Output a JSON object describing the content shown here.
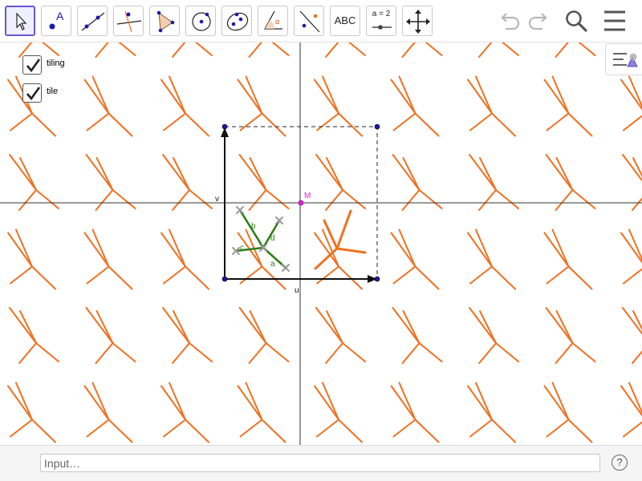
{
  "toolbar": {
    "tools": [
      {
        "id": "move",
        "text": ""
      },
      {
        "id": "point",
        "text": ""
      },
      {
        "id": "line",
        "text": ""
      },
      {
        "id": "perpendicular",
        "text": ""
      },
      {
        "id": "polygon",
        "text": ""
      },
      {
        "id": "circle",
        "text": ""
      },
      {
        "id": "ellipse",
        "text": ""
      },
      {
        "id": "angle",
        "text": ""
      },
      {
        "id": "reflect",
        "text": ""
      },
      {
        "id": "text",
        "text": "ABC"
      },
      {
        "id": "slider",
        "text": "a = 2"
      },
      {
        "id": "move-graphics",
        "text": ""
      }
    ],
    "right_icons": [
      "undo-icon",
      "redo-icon",
      "search-icon",
      "menu-icon"
    ]
  },
  "checkboxes": [
    {
      "label": "tiling",
      "checked": true
    },
    {
      "label": "tile",
      "checked": true
    }
  ],
  "graphics": {
    "point_M_label": "M",
    "vector_u_label": "u",
    "vector_v_label": "v",
    "segment_labels": [
      "a",
      "b",
      "c",
      "d"
    ],
    "colors": {
      "tiling": "#f07020",
      "tile_segments": "#2e7d16",
      "axes": "#333333",
      "frame_points": "#1a1aa8",
      "point_M": "#e020e0",
      "handles": "#999999"
    }
  },
  "input_bar": {
    "placeholder": "Input…",
    "help": "?"
  }
}
